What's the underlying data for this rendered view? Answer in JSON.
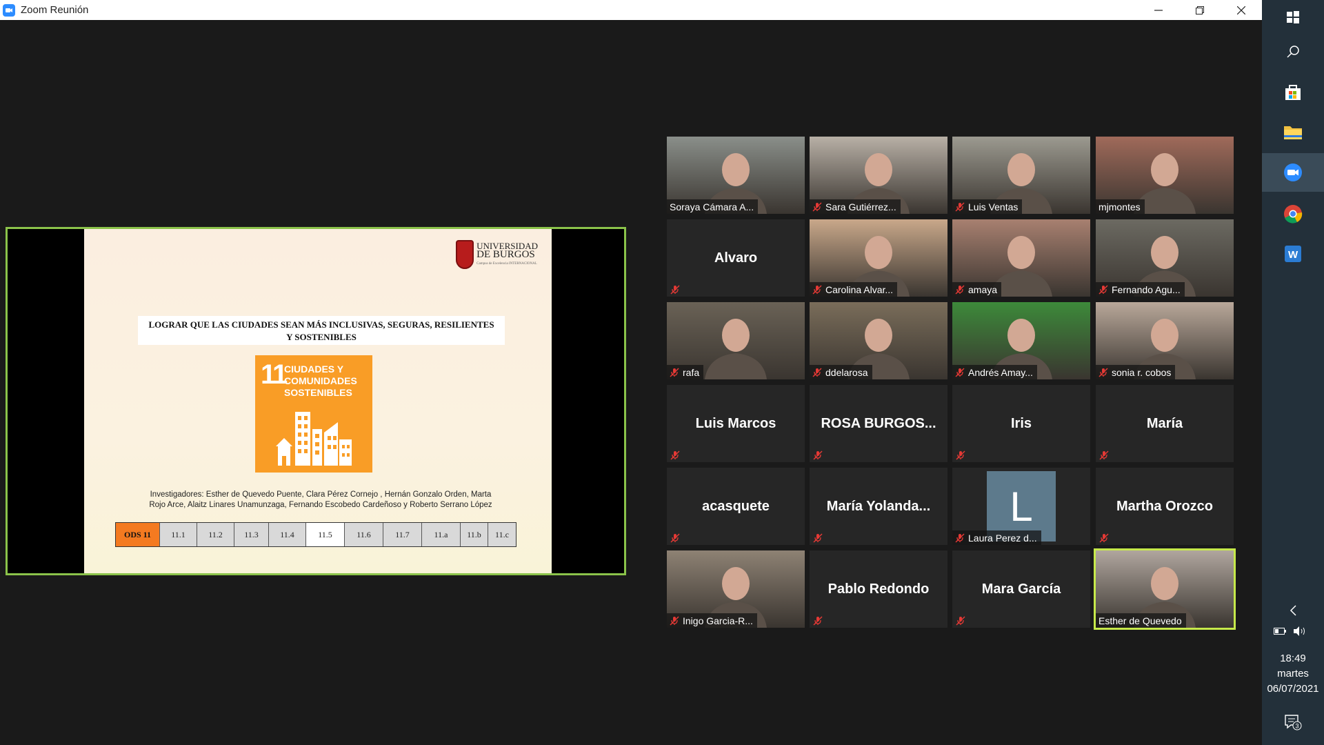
{
  "window": {
    "title": "Zoom Reunión"
  },
  "colors": {
    "accent_active": "#c6e94a",
    "share_border": "#8bc34a",
    "sdg_orange": "#f99d26",
    "mic_red": "#e53935",
    "taskbar": "#23303a"
  },
  "slide": {
    "logo_line1": "UNIVERSIDAD",
    "logo_line2": "DE BURGOS",
    "logo_line3": "Campus de Excelencia INTERNACIONAL",
    "title_line1": "LOGRAR QUE LAS CIUDADES SEAN MÁS INCLUSIVAS, SEGURAS, RESILIENTES",
    "title_line2": "Y SOSTENIBLES",
    "sdg_number": "11",
    "sdg_line1": "CIUDADES Y",
    "sdg_line2": "COMUNIDADES",
    "sdg_line3": "SOSTENIBLES",
    "investigators_line1": "Investigadores: Esther de Quevedo Puente, Clara Pérez Cornejo , Hernán Gonzalo Orden, Marta",
    "investigators_line2": "Rojo Arce, Alaitz Linares Unamunzaga, Fernando Escobedo Cardeñoso y Roberto Serrano López",
    "targets": [
      "ODS 11",
      "11.1",
      "11.2",
      "11.3",
      "11.4",
      "11.5",
      "11.6",
      "11.7",
      "11.a",
      "11.b",
      "11.c"
    ]
  },
  "participants": [
    {
      "name": "Soraya Cámara A...",
      "video": true,
      "muted": false
    },
    {
      "name": "Sara Gutiérrez...",
      "video": true,
      "muted": true
    },
    {
      "name": "Luis Ventas",
      "video": true,
      "muted": true
    },
    {
      "name": "mjmontes",
      "video": true,
      "muted": false
    },
    {
      "name": "Alvaro",
      "video": false,
      "muted": true
    },
    {
      "name": "Carolina Alvar...",
      "video": true,
      "muted": true
    },
    {
      "name": "amaya",
      "video": true,
      "muted": true
    },
    {
      "name": "Fernando Agu...",
      "video": true,
      "muted": true
    },
    {
      "name": "rafa",
      "video": true,
      "muted": true
    },
    {
      "name": "ddelarosa",
      "video": true,
      "muted": true
    },
    {
      "name": "Andrés Amay...",
      "video": true,
      "muted": true
    },
    {
      "name": "sonia r. cobos",
      "video": true,
      "muted": true
    },
    {
      "name": "Luis Marcos",
      "video": false,
      "muted": true
    },
    {
      "name": "ROSA  BURGOS...",
      "video": false,
      "muted": true
    },
    {
      "name": "Iris",
      "video": false,
      "muted": true
    },
    {
      "name": "María",
      "video": false,
      "muted": true
    },
    {
      "name": "acasquete",
      "video": false,
      "muted": true
    },
    {
      "name": "María  Yolanda...",
      "video": false,
      "muted": true
    },
    {
      "name": "Laura Perez d...",
      "video": false,
      "muted": true,
      "initial": "L"
    },
    {
      "name": "Martha Orozco",
      "video": false,
      "muted": true
    },
    {
      "name": "Inigo Garcia-R...",
      "video": true,
      "muted": true
    },
    {
      "name": "Pablo Redondo",
      "video": false,
      "muted": true
    },
    {
      "name": "Mara García",
      "video": false,
      "muted": true
    },
    {
      "name": "Esther de Quevedo",
      "video": true,
      "muted": false,
      "active": true
    }
  ],
  "taskbar": {
    "time": "18:49",
    "day": "martes",
    "date": "06/07/2021",
    "notifications": "3"
  }
}
